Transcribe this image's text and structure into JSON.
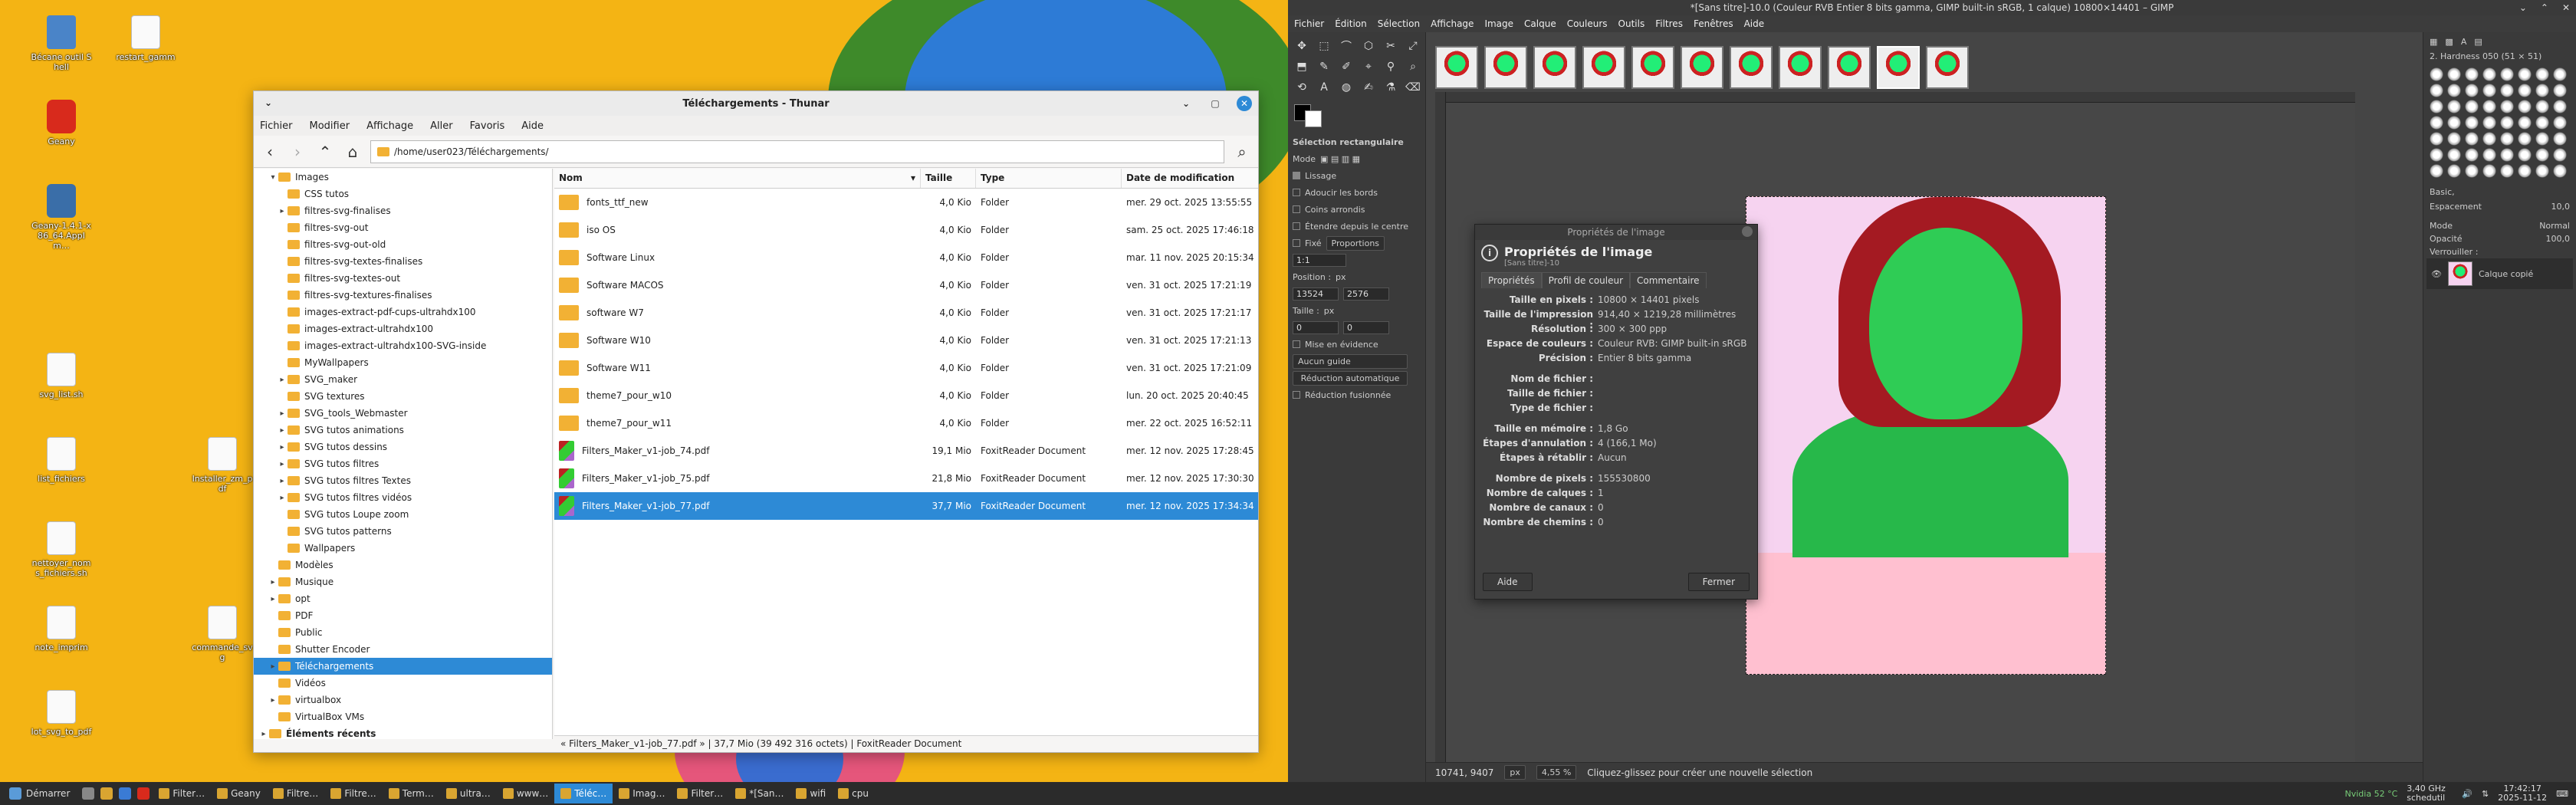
{
  "desktop": {
    "icons": [
      {
        "label": "Bécane outil Shell",
        "kind": "app"
      },
      {
        "label": "restart_gamm",
        "kind": "doc"
      },
      {
        "label": "Geany",
        "kind": "red"
      },
      {
        "label": "Geany-1.4.1-x86_64.AppIm…",
        "kind": "gear"
      },
      {
        "label": "svg_list.sh",
        "kind": "doc"
      },
      {
        "label": "list_fichiers",
        "kind": "doc"
      },
      {
        "label": "Installer_zm_pdf",
        "kind": "doc"
      },
      {
        "label": "nettoyer_noms_fichiers.sh",
        "kind": "doc"
      },
      {
        "label": "note_imprim",
        "kind": "doc"
      },
      {
        "label": "commande_svg",
        "kind": "doc"
      },
      {
        "label": "lot_svg_to_pdf",
        "kind": "doc"
      }
    ]
  },
  "thunar": {
    "title": "Téléchargements - Thunar",
    "menu": [
      "Fichier",
      "Modifier",
      "Affichage",
      "Aller",
      "Favoris",
      "Aide"
    ],
    "path": "/home/user023/Téléchargements/",
    "sidebar": [
      {
        "label": "Images",
        "level": 1,
        "exp": "▾"
      },
      {
        "label": "CSS tutos",
        "level": 2,
        "exp": ""
      },
      {
        "label": "filtres-svg-finalises",
        "level": 2,
        "exp": "▸"
      },
      {
        "label": "filtres-svg-out",
        "level": 2,
        "exp": ""
      },
      {
        "label": "filtres-svg-out-old",
        "level": 2,
        "exp": ""
      },
      {
        "label": "filtres-svg-textes-finalises",
        "level": 2,
        "exp": ""
      },
      {
        "label": "filtres-svg-textes-out",
        "level": 2,
        "exp": ""
      },
      {
        "label": "filtres-svg-textures-finalises",
        "level": 2,
        "exp": ""
      },
      {
        "label": "images-extract-pdf-cups-ultrahdx100",
        "level": 2,
        "exp": ""
      },
      {
        "label": "images-extract-ultrahdx100",
        "level": 2,
        "exp": ""
      },
      {
        "label": "images-extract-ultrahdx100-SVG-inside",
        "level": 2,
        "exp": ""
      },
      {
        "label": "MyWallpapers",
        "level": 2,
        "exp": ""
      },
      {
        "label": "SVG_maker",
        "level": 2,
        "exp": "▸"
      },
      {
        "label": "SVG textures",
        "level": 2,
        "exp": ""
      },
      {
        "label": "SVG_tools_Webmaster",
        "level": 2,
        "exp": "▸"
      },
      {
        "label": "SVG tutos animations",
        "level": 2,
        "exp": "▸"
      },
      {
        "label": "SVG tutos dessins",
        "level": 2,
        "exp": "▸"
      },
      {
        "label": "SVG tutos filtres",
        "level": 2,
        "exp": "▸"
      },
      {
        "label": "SVG tutos filtres Textes",
        "level": 2,
        "exp": "▸"
      },
      {
        "label": "SVG tutos filtres vidéos",
        "level": 2,
        "exp": "▸"
      },
      {
        "label": "SVG tutos Loupe zoom",
        "level": 2,
        "exp": ""
      },
      {
        "label": "SVG tutos patterns",
        "level": 2,
        "exp": ""
      },
      {
        "label": "Wallpapers",
        "level": 2,
        "exp": ""
      },
      {
        "label": "Modèles",
        "level": 1,
        "exp": ""
      },
      {
        "label": "Musique",
        "level": 1,
        "exp": "▸"
      },
      {
        "label": "opt",
        "level": 1,
        "exp": "▸"
      },
      {
        "label": "PDF",
        "level": 1,
        "exp": ""
      },
      {
        "label": "Public",
        "level": 1,
        "exp": ""
      },
      {
        "label": "Shutter Encoder",
        "level": 1,
        "exp": ""
      },
      {
        "label": "Téléchargements",
        "level": 1,
        "exp": "▸",
        "selected": true
      },
      {
        "label": "Vidéos",
        "level": 1,
        "exp": ""
      },
      {
        "label": "virtualbox",
        "level": 1,
        "exp": "▸"
      },
      {
        "label": "VirtualBox VMs",
        "level": 1,
        "exp": ""
      },
      {
        "label": "Éléments récents",
        "level": 0,
        "exp": "▸",
        "bold": true
      },
      {
        "label": "Corbeille",
        "level": 0,
        "exp": "",
        "bold": true
      }
    ],
    "columns": {
      "name": "Nom",
      "size": "Taille",
      "type": "Type",
      "date": "Date de modification"
    },
    "files": [
      {
        "name": "fonts_ttf_new",
        "size": "4,0 Kio",
        "type": "Folder",
        "date": "mer. 29 oct. 2025 13:55:55",
        "kind": "folder"
      },
      {
        "name": "iso OS",
        "size": "4,0 Kio",
        "type": "Folder",
        "date": "sam. 25 oct. 2025 17:46:18",
        "kind": "folder"
      },
      {
        "name": "Software Linux",
        "size": "4,0 Kio",
        "type": "Folder",
        "date": "mar. 11 nov. 2025 20:15:34",
        "kind": "folder"
      },
      {
        "name": "Software MACOS",
        "size": "4,0 Kio",
        "type": "Folder",
        "date": "ven. 31 oct. 2025 17:21:19",
        "kind": "folder"
      },
      {
        "name": "software W7",
        "size": "4,0 Kio",
        "type": "Folder",
        "date": "ven. 31 oct. 2025 17:21:17",
        "kind": "folder"
      },
      {
        "name": "Software W10",
        "size": "4,0 Kio",
        "type": "Folder",
        "date": "ven. 31 oct. 2025 17:21:13",
        "kind": "folder"
      },
      {
        "name": "Software W11",
        "size": "4,0 Kio",
        "type": "Folder",
        "date": "ven. 31 oct. 2025 17:21:09",
        "kind": "folder"
      },
      {
        "name": "theme7_pour_w10",
        "size": "4,0 Kio",
        "type": "Folder",
        "date": "lun. 20 oct. 2025 20:40:45",
        "kind": "folder"
      },
      {
        "name": "theme7_pour_w11",
        "size": "4,0 Kio",
        "type": "Folder",
        "date": "mer. 22 oct. 2025 16:52:11",
        "kind": "folder"
      },
      {
        "name": "Filters_Maker_v1-job_74.pdf",
        "size": "19,1 Mio",
        "type": "FoxitReader Document",
        "date": "mer. 12 nov. 2025 17:28:45",
        "kind": "pdf"
      },
      {
        "name": "Filters_Maker_v1-job_75.pdf",
        "size": "21,8 Mio",
        "type": "FoxitReader Document",
        "date": "mer. 12 nov. 2025 17:30:30",
        "kind": "pdf"
      },
      {
        "name": "Filters_Maker_v1-job_77.pdf",
        "size": "37,7 Mio",
        "type": "FoxitReader Document",
        "date": "mer. 12 nov. 2025 17:34:34",
        "kind": "pdf",
        "selected": true
      }
    ],
    "status": "« Filters_Maker_v1-job_77.pdf » | 37,7 Mio (39 492 316 octets) | FoxitReader Document"
  },
  "gimp": {
    "title": "*[Sans titre]-10.0 (Couleur RVB Entier 8 bits gamma, GIMP built-in sRGB, 1 calque) 10800×14401 – GIMP",
    "menu": [
      "Fichier",
      "Édition",
      "Sélection",
      "Affichage",
      "Image",
      "Calque",
      "Couleurs",
      "Outils",
      "Filtres",
      "Fenêtres",
      "Aide"
    ],
    "tool_options": {
      "title": "Sélection rectangulaire",
      "mode": "Mode",
      "lissage": "Lissage",
      "adoucir": "Adoucir les bords",
      "coins": "Coins arrondis",
      "etendre": "Étendre depuis le centre",
      "fixe": "Fixé",
      "proportions": "Proportions",
      "ratio": "1:1",
      "position": "Position :",
      "pos_x": "13524",
      "pos_y": "2576",
      "unit": "px",
      "taille": "Taille :",
      "size_w": "0",
      "size_h": "0",
      "mise": "Mise en évidence",
      "guide": "Aucun guide",
      "reduction": "Réduction automatique",
      "fusionne": "Réduction fusionnée"
    },
    "properties": {
      "dialog_title": "Propriétés de l'image",
      "heading": "Propriétés de l'image",
      "subheading": "[Sans titre]-10",
      "tabs": [
        "Propriétés",
        "Profil de couleur",
        "Commentaire"
      ],
      "rows": [
        {
          "k": "Taille en pixels :",
          "v": "10800 × 14401 pixels"
        },
        {
          "k": "Taille de l'impression :",
          "v": "914,40 × 1219,28 millimètres"
        },
        {
          "k": "Résolution :",
          "v": "300 × 300 ppp"
        },
        {
          "k": "Espace de couleurs :",
          "v": "Couleur RVB: GIMP built-in sRGB"
        },
        {
          "k": "Précision :",
          "v": "Entier 8 bits gamma"
        },
        {
          "k": "",
          "v": ""
        },
        {
          "k": "Nom de fichier :",
          "v": ""
        },
        {
          "k": "Taille de fichier :",
          "v": ""
        },
        {
          "k": "Type de fichier :",
          "v": ""
        },
        {
          "k": "",
          "v": ""
        },
        {
          "k": "Taille en mémoire :",
          "v": "1,8 Go"
        },
        {
          "k": "Étapes d'annulation :",
          "v": "4 (166,1 Mo)"
        },
        {
          "k": "Étapes à rétablir :",
          "v": "Aucun"
        },
        {
          "k": "",
          "v": ""
        },
        {
          "k": "Nombre de pixels :",
          "v": "155530800"
        },
        {
          "k": "Nombre de calques :",
          "v": "1"
        },
        {
          "k": "Nombre de canaux :",
          "v": "0"
        },
        {
          "k": "Nombre de chemins :",
          "v": "0"
        }
      ],
      "help": "Aide",
      "close": "Fermer"
    },
    "dock": {
      "brush_name": "2. Hardness 050 (51 × 51)",
      "preset": "Basic,",
      "espacement": "Espacement",
      "espacement_val": "10,0",
      "mode": "Mode",
      "mode_val": "Normal",
      "opacite": "Opacité",
      "opacite_val": "100,0",
      "verrouiller": "Verrouiller :",
      "layer_name": "Calque copié"
    },
    "status": {
      "coords": "10741, 9407",
      "unit": "px",
      "zoom": "4,55 %",
      "message": "Cliquez-glissez pour créer une nouvelle sélection"
    }
  },
  "taskbar": {
    "start": "Démarrer",
    "tasks": [
      {
        "label": "Filter…"
      },
      {
        "label": "Geany"
      },
      {
        "label": "Filtre…"
      },
      {
        "label": "Filtre…"
      },
      {
        "label": "Term…"
      },
      {
        "label": "ultra…"
      },
      {
        "label": "www…"
      },
      {
        "label": "Téléc…",
        "active": true
      },
      {
        "label": "Imag…"
      },
      {
        "label": "Filter…"
      },
      {
        "label": "*[San…"
      },
      {
        "label": "wifi"
      },
      {
        "label": "cpu"
      }
    ],
    "tray": {
      "nvidia": "Nvidia 52 °C",
      "cpu": "3,40 GHz schedutil",
      "time": "17:42:17",
      "date": "2025-11-12"
    }
  },
  "colors": {
    "accent": "#2d8ad6",
    "desktop": "#f4b414",
    "gimp_bg": "#454545",
    "folder": "#f2b134"
  }
}
